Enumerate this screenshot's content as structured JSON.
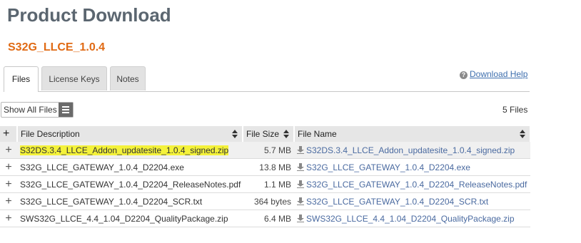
{
  "header": {
    "title": "Product Download",
    "product": "S32G_LLCE_1.0.4"
  },
  "tabs": [
    {
      "label": "Files"
    },
    {
      "label": "License Keys"
    },
    {
      "label": "Notes"
    }
  ],
  "help": {
    "label": "Download Help"
  },
  "toolbar": {
    "show_all_label": "Show All Files",
    "file_count": "5 Files"
  },
  "table": {
    "columns": {
      "description": "File Description",
      "size": "File Size",
      "name": "File Name"
    },
    "rows": [
      {
        "description": "S32DS.3.4_LLCE_Addon_updatesite_1.0.4_signed.zip",
        "size": "5.7 MB",
        "name": "S32DS.3.4_LLCE_Addon_updatesite_1.0.4_signed.zip"
      },
      {
        "description": "S32G_LLCE_GATEWAY_1.0.4_D2204.exe",
        "size": "13.8 MB",
        "name": "S32G_LLCE_GATEWAY_1.0.4_D2204.exe"
      },
      {
        "description": "S32G_LLCE_GATEWAY_1.0.4_D2204_ReleaseNotes.pdf",
        "size": "1.1 MB",
        "name": "S32G_LLCE_GATEWAY_1.0.4_D2204_ReleaseNotes.pdf"
      },
      {
        "description": "S32G_LLCE_GATEWAY_1.0.4_D2204_SCR.txt",
        "size": "364 bytes",
        "name": "S32G_LLCE_GATEWAY_1.0.4_D2204_SCR.txt"
      },
      {
        "description": "SWS32G_LLCE_4.4_1.04_D2204_QualityPackage.zip",
        "size": "6.4 MB",
        "name": "SWS32G_LLCE_4.4_1.04_D2204_QualityPackage.zip"
      }
    ]
  },
  "icons": {
    "expand": "plus-icon",
    "download": "download-icon",
    "sort": "sort-icon",
    "help": "help-icon",
    "menu": "menu-icon"
  },
  "colors": {
    "title": "#5b6670",
    "product": "#e06a14",
    "link": "#4a6aa0",
    "highlight": "#f4f23a"
  }
}
